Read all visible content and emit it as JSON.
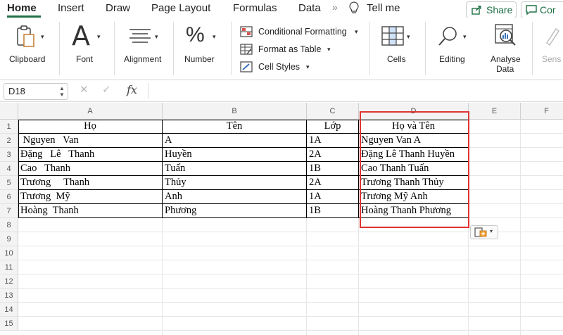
{
  "tabs": [
    "Home",
    "Insert",
    "Draw",
    "Page Layout",
    "Formulas",
    "Data"
  ],
  "tell_me": "Tell me",
  "share_label": "Share",
  "comments_label": "Cor",
  "ribbon": {
    "clipboard": "Clipboard",
    "font": "Font",
    "alignment": "Alignment",
    "number": "Number",
    "conditional_formatting": "Conditional Formatting",
    "format_as_table": "Format as Table",
    "cell_styles": "Cell Styles",
    "cells": "Cells",
    "editing": "Editing",
    "analyse_data_1": "Analyse",
    "analyse_data_2": "Data",
    "sensitivity": "Sens"
  },
  "formula_bar": {
    "name_box": "D18",
    "fx": "fx",
    "cancel_icon": "x-icon",
    "confirm_icon": "check-icon"
  },
  "columns": [
    "A",
    "B",
    "C",
    "D",
    "E",
    "F"
  ],
  "rows": [
    "1",
    "2",
    "3",
    "4",
    "5",
    "6",
    "7",
    "8",
    "9",
    "10",
    "11",
    "12",
    "13",
    "14",
    "15"
  ],
  "sheet": {
    "headers": [
      "Họ",
      "Tên",
      "Lớp",
      "Họ và Tên"
    ],
    "data": [
      [
        " Nguyen   Van",
        "A",
        "1A",
        "Nguyen Van A"
      ],
      [
        "Đặng   Lê   Thanh",
        "Huyền",
        "2A",
        "Đặng Lê Thanh Huyền"
      ],
      [
        "Cao   Thanh",
        "Tuấn",
        "1B",
        "Cao Thanh Tuấn"
      ],
      [
        "Trương     Thanh",
        "Thủy",
        "2A",
        "Trương Thanh Thủy"
      ],
      [
        "Trương  Mỹ",
        "Anh",
        "1A",
        "Trương Mỹ Anh"
      ],
      [
        "Hoàng  Thanh",
        "Phương",
        "1B",
        "Hoàng Thanh Phương"
      ]
    ]
  },
  "colors": {
    "accent": "#1e7145",
    "highlight": "#e03434"
  }
}
